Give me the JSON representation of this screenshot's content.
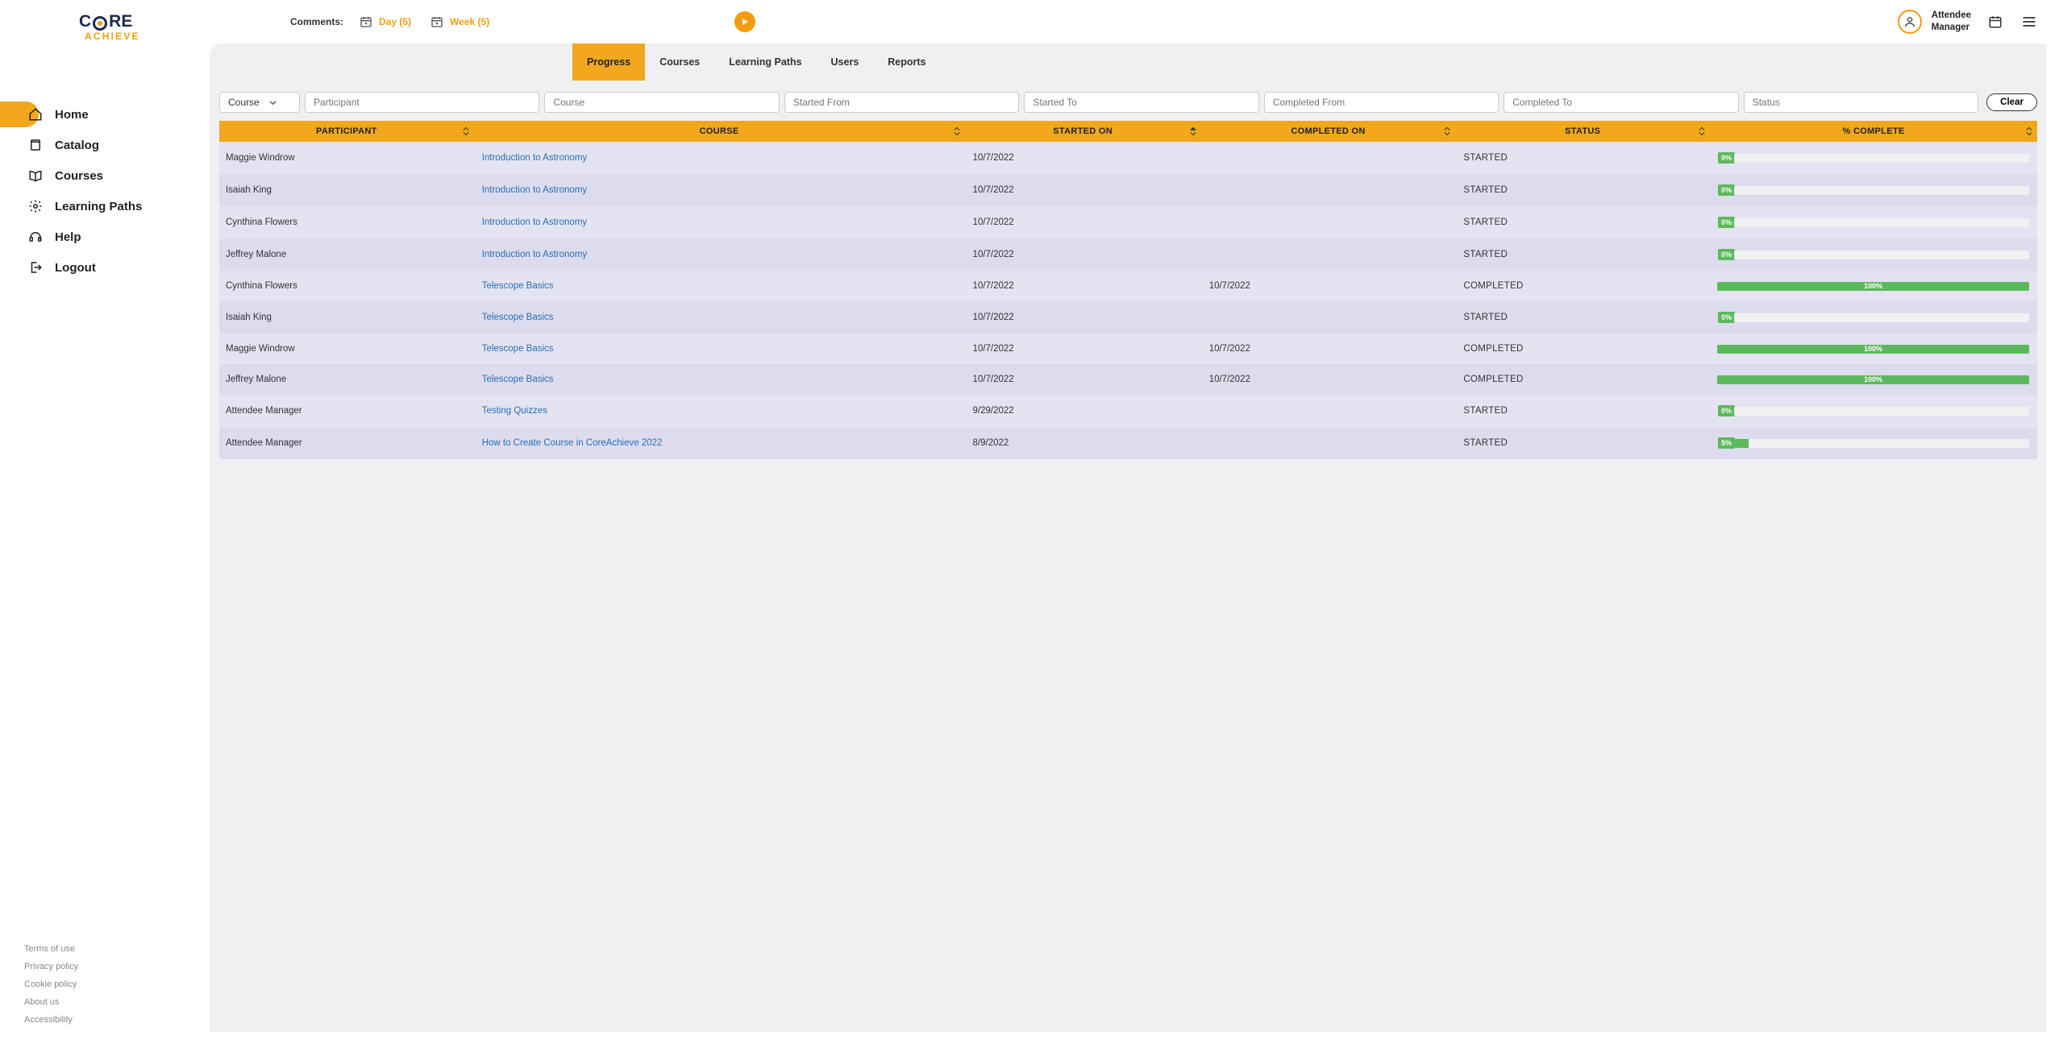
{
  "brand": {
    "top": "C   RE",
    "bottom": "ACHIEVE"
  },
  "sidebar": {
    "items": [
      {
        "label": "Home",
        "icon": "home-icon",
        "active": true
      },
      {
        "label": "Catalog",
        "icon": "book-icon",
        "active": false
      },
      {
        "label": "Courses",
        "icon": "open-book-icon",
        "active": false
      },
      {
        "label": "Learning Paths",
        "icon": "gear-icon",
        "active": false
      },
      {
        "label": "Help",
        "icon": "headset-icon",
        "active": false
      },
      {
        "label": "Logout",
        "icon": "logout-icon",
        "active": false
      }
    ],
    "footer": [
      "Terms of use",
      "Privacy policy",
      "Cookie policy",
      "About us",
      "Accessibility"
    ]
  },
  "topbar": {
    "comments_label": "Comments:",
    "day_label": "Day (",
    "day_count": "5",
    "day_close": ")",
    "week_label": "Week (",
    "week_count": "5",
    "week_close": ")",
    "user_line1": "Attendee",
    "user_line2": "Manager"
  },
  "tabs": [
    {
      "label": "Progress",
      "active": true
    },
    {
      "label": "Courses",
      "active": false
    },
    {
      "label": "Learning Paths",
      "active": false
    },
    {
      "label": "Users",
      "active": false
    },
    {
      "label": "Reports",
      "active": false
    }
  ],
  "filters": {
    "type_select": "Course",
    "participant_ph": "Participant",
    "course_ph": "Course",
    "started_from_ph": "Started From",
    "started_to_ph": "Started To",
    "completed_from_ph": "Completed From",
    "completed_to_ph": "Completed To",
    "status_ph": "Status",
    "clear_label": "Clear"
  },
  "columns": [
    "PARTICIPANT",
    "COURSE",
    "STARTED ON",
    "COMPLETED ON",
    "STATUS",
    "% COMPLETE"
  ],
  "rows": [
    {
      "participant": "Maggie Windrow",
      "course": "Introduction to Astronomy",
      "started": "10/7/2022",
      "completed": "",
      "status": "STARTED",
      "percent": 0
    },
    {
      "participant": "Isaiah King",
      "course": "Introduction to Astronomy",
      "started": "10/7/2022",
      "completed": "",
      "status": "STARTED",
      "percent": 0
    },
    {
      "participant": "Cynthina Flowers",
      "course": "Introduction to Astronomy",
      "started": "10/7/2022",
      "completed": "",
      "status": "STARTED",
      "percent": 0
    },
    {
      "participant": "Jeffrey Malone",
      "course": "Introduction to Astronomy",
      "started": "10/7/2022",
      "completed": "",
      "status": "STARTED",
      "percent": 0
    },
    {
      "participant": "Cynthina Flowers",
      "course": "Telescope Basics",
      "started": "10/7/2022",
      "completed": "10/7/2022",
      "status": "COMPLETED",
      "percent": 100
    },
    {
      "participant": "Isaiah King",
      "course": "Telescope Basics",
      "started": "10/7/2022",
      "completed": "",
      "status": "STARTED",
      "percent": 0
    },
    {
      "participant": "Maggie Windrow",
      "course": "Telescope Basics",
      "started": "10/7/2022",
      "completed": "10/7/2022",
      "status": "COMPLETED",
      "percent": 100
    },
    {
      "participant": "Jeffrey Malone",
      "course": "Telescope Basics",
      "started": "10/7/2022",
      "completed": "10/7/2022",
      "status": "COMPLETED",
      "percent": 100
    },
    {
      "participant": "Attendee Manager",
      "course": "Testing Quizzes",
      "started": "9/29/2022",
      "completed": "",
      "status": "STARTED",
      "percent": 0
    },
    {
      "participant": "Attendee Manager",
      "course": "How to Create Course in CoreAchieve 2022",
      "started": "8/9/2022",
      "completed": "",
      "status": "STARTED",
      "percent": 5
    }
  ]
}
